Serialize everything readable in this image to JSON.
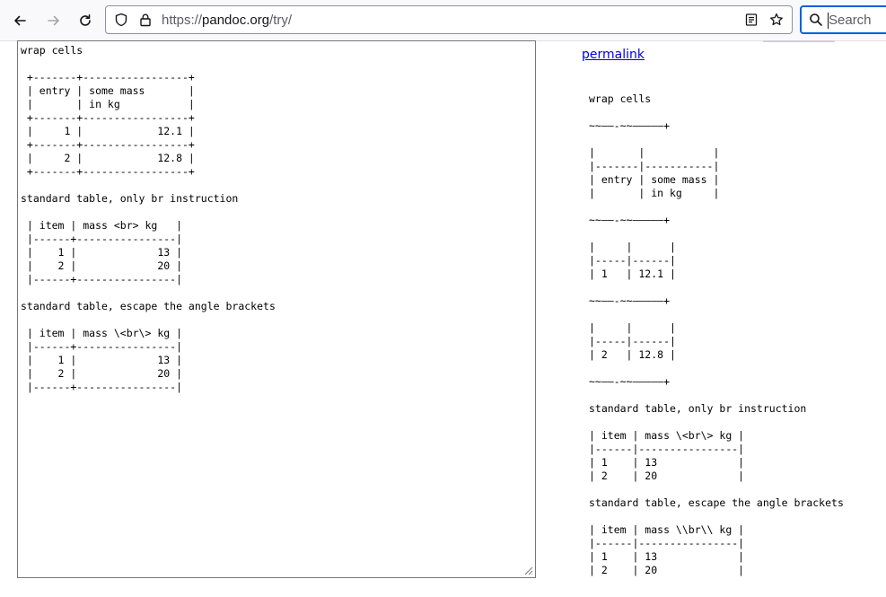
{
  "browser": {
    "url_scheme": "https://",
    "url_host": "pandoc.org",
    "url_path": "/try/",
    "search_placeholder": "Search",
    "icons": {
      "back": "arrow-left-icon",
      "forward": "arrow-right-icon",
      "reload": "reload-icon",
      "tracking_protection": "shield-icon",
      "connection": "lock-icon",
      "reader_view": "reader-view-icon",
      "bookmark": "star-icon",
      "search": "search-icon"
    }
  },
  "page": {
    "input_text": "wrap cells\n\n +-------+-----------------+\n | entry | some mass       |\n |       | in kg           |\n +-------+-----------------+\n |     1 |            12.1 |\n +-------+-----------------+\n |     2 |            12.8 |\n +-------+-----------------+\n\nstandard table, only br instruction\n\n | item | mass <br> kg   |\n |------+----------------|\n |    1 |             13 |\n |    2 |             20 |\n |------+----------------|\n\nstandard table, escape the angle brackets\n\n | item | mass \\<br\\> kg |\n |------+----------------|\n |    1 |             13 |\n |    2 |             20 |\n |------+----------------|",
    "permalink_label": "permalink",
    "output_text": "wrap cells\n\n~~——-~~—————+\n\n|       |           |\n|-------|-----------|\n| entry | some mass |\n|       | in kg     |\n\n~~——-~~—————+\n\n|     |      |\n|-----|------|\n| 1   | 12.1 |\n\n~~——-~~—————+\n\n|     |      |\n|-----|------|\n| 2   | 12.8 |\n\n~~——-~~—————+\n\nstandard table, only br instruction\n\n| item | mass \\<br\\> kg |\n|------|----------------|\n| 1    | 13             |\n| 2    | 20             |\n\nstandard table, escape the angle brackets\n\n| item | mass \\\\br\\\\ kg |\n|------|----------------|\n| 1    | 13             |\n| 2    | 20             |"
  }
}
